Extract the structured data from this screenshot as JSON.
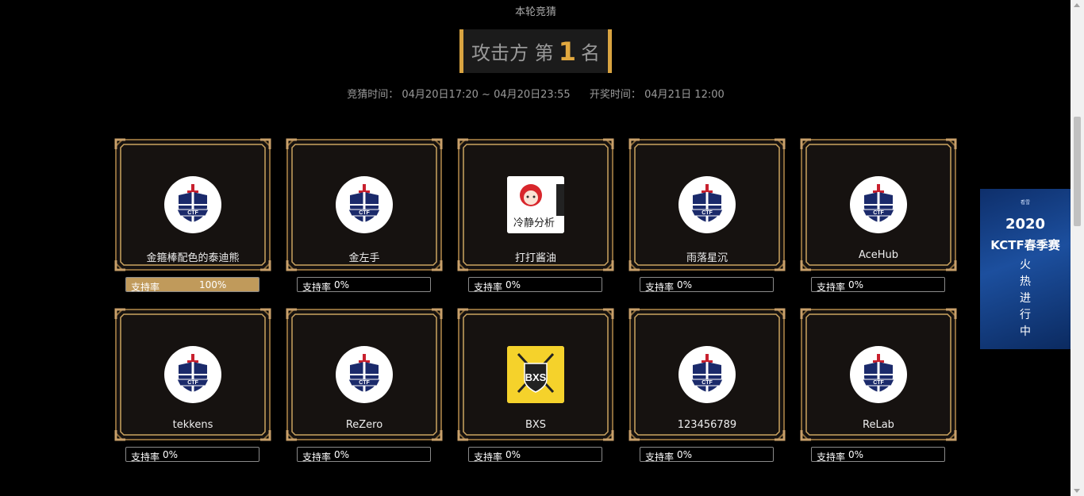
{
  "round_label": "本轮竞猜",
  "rank": {
    "prefix": "攻击方 第",
    "number": "1",
    "suffix": "名"
  },
  "times": {
    "guess_label": "竞猜时间：",
    "guess_range": "04月20日17:20 ~ 04月20日23:55",
    "draw_label": "开奖时间：",
    "draw_time": "04月21日 12:00"
  },
  "support_label": "支持率",
  "teams": [
    {
      "name": "金箍棒配色的泰迪熊",
      "avatar": "ctf-shield",
      "support": "100%",
      "support_value": 1.0
    },
    {
      "name": "金左手",
      "avatar": "ctf-shield",
      "support": "0%",
      "support_value": 0
    },
    {
      "name": "打打酱油",
      "avatar": "anime-girl",
      "avatar_text": "冷静分析",
      "support": "0%",
      "support_value": 0
    },
    {
      "name": "雨落星沉",
      "avatar": "ctf-shield",
      "support": "0%",
      "support_value": 0
    },
    {
      "name": "AceHub",
      "avatar": "ctf-shield",
      "support": "0%",
      "support_value": 0
    },
    {
      "name": "tekkens",
      "avatar": "ctf-shield",
      "support": "0%",
      "support_value": 0
    },
    {
      "name": "ReZero",
      "avatar": "ctf-shield",
      "support": "0%",
      "support_value": 0
    },
    {
      "name": "BXS",
      "avatar": "bxs-logo",
      "avatar_text": "BXS",
      "support": "0%",
      "support_value": 0
    },
    {
      "name": "123456789",
      "avatar": "ctf-shield",
      "support": "0%",
      "support_value": 0
    },
    {
      "name": "ReLab",
      "avatar": "ctf-shield",
      "support": "0%",
      "support_value": 0
    }
  ],
  "shield_text": "CTF",
  "ad": {
    "brand": "看雪",
    "year": "2020",
    "event": "KCTF春季赛",
    "status": "火热进行中"
  },
  "colors": {
    "gold": "#d9a441",
    "fill": "#c09a5b",
    "card_bg": "#161210",
    "navy": "#1b2a6b",
    "red": "#c8202e"
  }
}
